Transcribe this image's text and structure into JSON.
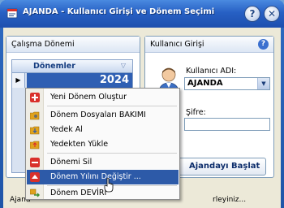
{
  "window": {
    "title": "AJANDA - Kullanıcı Girişi ve Dönem Seçimi",
    "help_label": "?",
    "close_label": "✕"
  },
  "left_panel": {
    "title": "Çalışma Dönemi",
    "grid": {
      "column": "Dönemler",
      "filter_icon": "filter-icon",
      "row_indicator": "▶",
      "rows": [
        "2024"
      ]
    }
  },
  "right_panel": {
    "title": "Kullanıcı Girişi",
    "help": "?",
    "user_label": "Kullanıcı ADI:",
    "user_value": "AJANDA",
    "password_label": "Şifre:",
    "start_button": "Ajandayı Başlat"
  },
  "status": {
    "left": "Ajand",
    "right": "rleyiniz..."
  },
  "context_menu": {
    "items": [
      {
        "label": "Yeni Dönem Oluştur",
        "icon": "plus-icon",
        "color": "#d9302b"
      },
      {
        "label": "Dönem Dosyaları BAKIMI",
        "icon": "folder-gear-icon",
        "color": "#e0a21c"
      },
      {
        "label": "Yedek Al",
        "icon": "folder-backup-icon",
        "color": "#e0a21c"
      },
      {
        "label": "Yedekten Yükle",
        "icon": "folder-restore-icon",
        "color": "#e0a21c"
      },
      {
        "label": "Dönemi Sil",
        "icon": "minus-icon",
        "color": "#d9302b"
      },
      {
        "label": "Dönem Yılını Değiştir ...",
        "icon": "up-arrow-icon",
        "color": "#d9302b"
      },
      {
        "label": "Dönem DEVİRİ",
        "icon": "transfer-icon",
        "color": "#3a8f2e"
      }
    ],
    "selected_index": 5
  },
  "colors": {
    "title_bar": "#2760c4",
    "selection": "#2d5aa8",
    "grid_selection": "#2f5fb3"
  }
}
